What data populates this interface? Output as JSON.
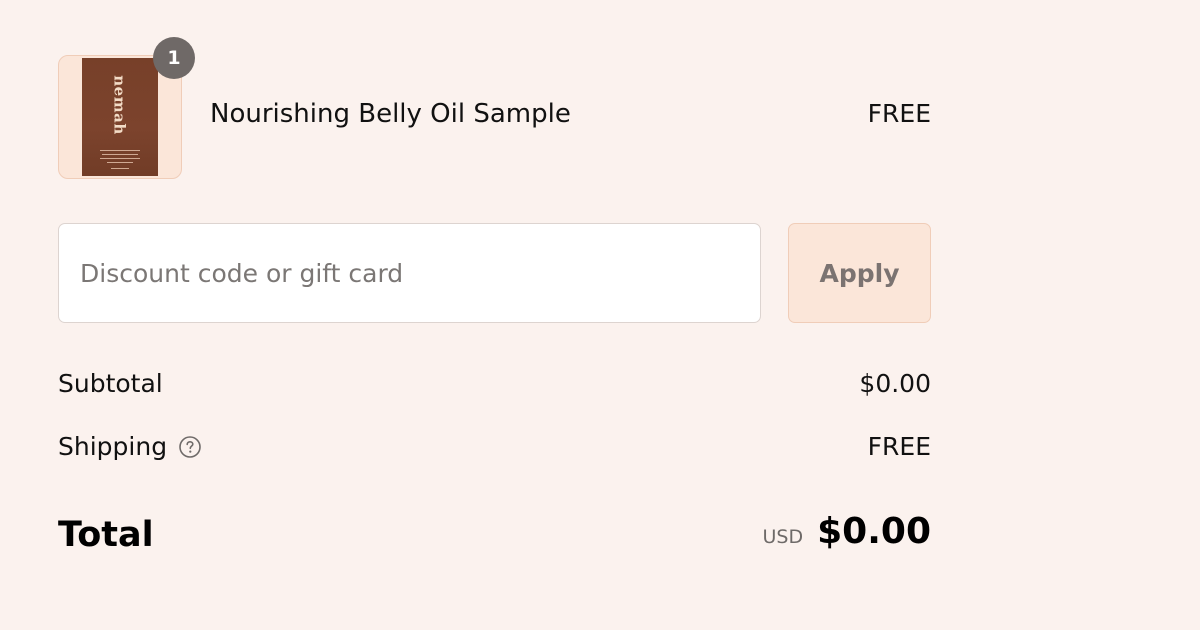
{
  "product": {
    "name": "Nourishing Belly Oil Sample",
    "price": "FREE",
    "quantity": "1",
    "image_brand_text": "nemah"
  },
  "discount": {
    "placeholder": "Discount code or gift card",
    "value": "",
    "apply_label": "Apply"
  },
  "summary": {
    "subtotal_label": "Subtotal",
    "subtotal_value": "$0.00",
    "shipping_label": "Shipping",
    "shipping_value": "FREE",
    "total_label": "Total",
    "currency": "USD",
    "total_value": "$0.00"
  },
  "icons": {
    "shipping_help": "question-circle-icon"
  },
  "colors": {
    "background": "#fbf2ee",
    "accent_light": "#fbe6d9",
    "badge": "#6f6967",
    "packaging": "#774029"
  }
}
